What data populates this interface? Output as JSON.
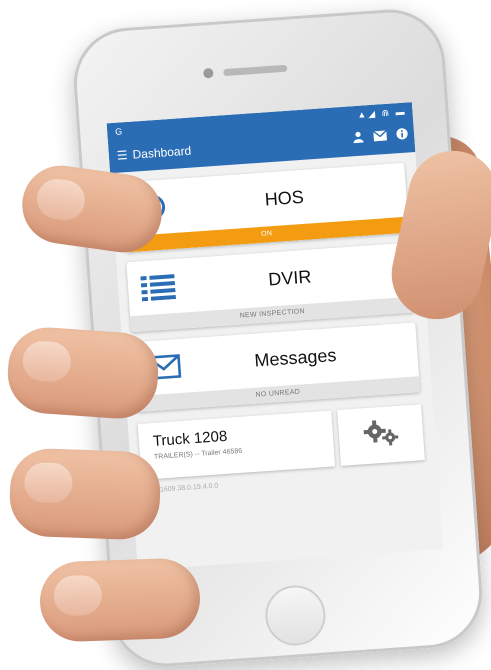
{
  "status": {
    "left": "G",
    "right": "▲◢ ⋒ ▬"
  },
  "appbar": {
    "menu_icon": "menu-icon",
    "title": "Dashboard",
    "icons": [
      "person-icon",
      "mail-icon",
      "info-icon"
    ]
  },
  "cards": {
    "hos": {
      "title": "HOS",
      "footer": "ON",
      "icon": "clock-icon"
    },
    "dvir": {
      "title": "DVIR",
      "footer": "NEW INSPECTION",
      "icon": "list-icon"
    },
    "messages": {
      "title": "Messages",
      "footer": "NO UNREAD",
      "icon": "envelope-icon"
    }
  },
  "truck": {
    "name": "Truck 1208",
    "trailer": "TRAILER(S) -- Trailer 46586"
  },
  "settings": {
    "icon": "gears-icon"
  },
  "version": "5.7.1609.38.0.19.4.0.0",
  "colors": {
    "appbar": "#2a6db5",
    "accent_orange": "#f39c12",
    "icon_blue": "#2a6db5"
  }
}
